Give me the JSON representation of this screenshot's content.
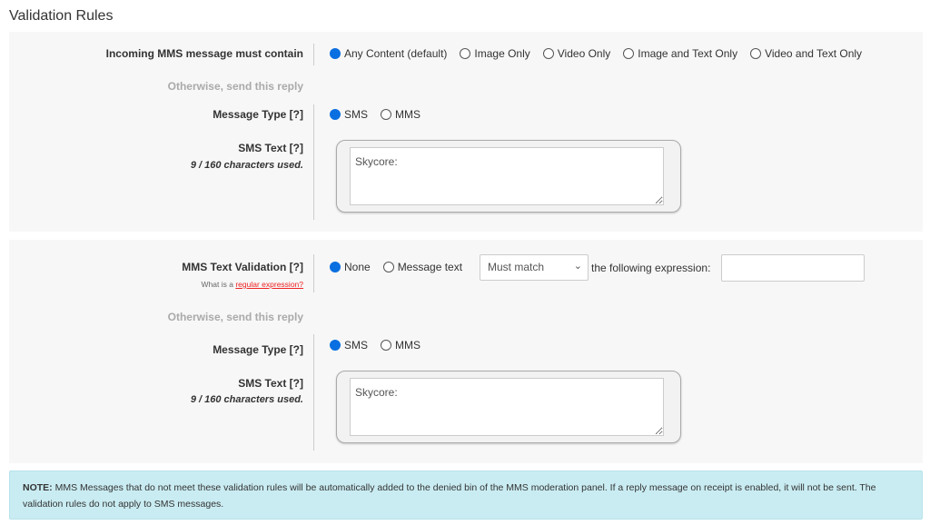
{
  "title": "Validation Rules",
  "section1": {
    "content_label": "Incoming MMS message must contain",
    "content_options": [
      {
        "label": "Any Content (default)",
        "selected": true
      },
      {
        "label": "Image Only",
        "selected": false
      },
      {
        "label": "Video Only",
        "selected": false
      },
      {
        "label": "Image and Text Only",
        "selected": false
      },
      {
        "label": "Video and Text Only",
        "selected": false
      }
    ],
    "otherwise": "Otherwise, send this reply",
    "message_type_label": "Message Type [?]",
    "message_type_options": [
      {
        "label": "SMS",
        "selected": true
      },
      {
        "label": "MMS",
        "selected": false
      }
    ],
    "sms_text_label": "SMS Text [?]",
    "chars_used": "9 / 160 characters used.",
    "sms_text_value": "Skycore:"
  },
  "section2": {
    "validation_label": "MMS Text Validation [?]",
    "regex_prefix": "What is a ",
    "regex_link": "regular expression?",
    "validation_options": [
      {
        "label": "None",
        "selected": true
      },
      {
        "label": "Message text",
        "selected": false
      }
    ],
    "match_select": "Must match",
    "expression_label": "the following expression:",
    "expression_value": "",
    "otherwise": "Otherwise, send this reply",
    "message_type_label": "Message Type [?]",
    "message_type_options": [
      {
        "label": "SMS",
        "selected": true
      },
      {
        "label": "MMS",
        "selected": false
      }
    ],
    "sms_text_label": "SMS Text [?]",
    "chars_used": "9 / 160 characters used.",
    "sms_text_value": "Skycore:"
  },
  "note": {
    "bold": "NOTE:",
    "text": " MMS Messages that do not meet these validation rules will be automatically added to the denied bin of the MMS moderation panel. If a reply message on receipt is enabled, it will not be sent. The validation rules do not apply to SMS messages."
  },
  "colors": {
    "accent": "#0a6fe0",
    "note_bg": "#c9ecf2",
    "panel_bg": "#f7f7f7",
    "link": "#e22222"
  }
}
